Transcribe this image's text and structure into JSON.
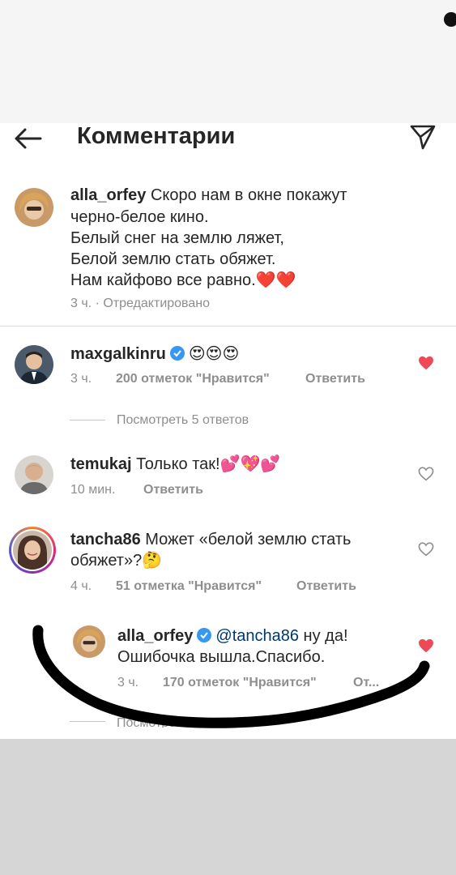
{
  "header": {
    "title": "Комментарии"
  },
  "caption": {
    "username": "alla_orfey",
    "lines": [
      "Скоро нам в окне покажут",
      "черно-белое кино.",
      "Белый снег на землю ляжет,",
      "Белой землю стать обяжет.",
      "Нам кайфово все равно.❤️❤️"
    ],
    "time": "3 ч.",
    "edited": "· Отредактировано"
  },
  "comments": [
    {
      "username": "maxgalkinru",
      "text": "😍😍😍",
      "time": "3 ч.",
      "likes": "200 отметок \"Нравится\"",
      "reply": "Ответить",
      "liked": true,
      "view_replies": "Посмотреть 5 ответов"
    },
    {
      "username": "temukaj",
      "text": "Только так!💕💖💕",
      "time": "10 мин.",
      "reply": "Ответить",
      "liked": false
    },
    {
      "username": "tancha86",
      "text_line1": "Может «белой землю стать",
      "text_line2": "обяжет»?🤔",
      "time": "4 ч.",
      "likes": "51 отметка \"Нравится\"",
      "reply": "Ответить",
      "liked": false
    }
  ],
  "reply": {
    "username": "alla_orfey",
    "mention": "@tancha86",
    "text_rest": " ну да!",
    "text_line2": "Ошибочка вышла.Спасибо.",
    "time": "3 ч.",
    "likes": "170 отметок \"Нравится\"",
    "reply_truncated": "От...",
    "liked": true
  },
  "hidden_view_replies": "Посмотреть ответов",
  "colors": {
    "like_red": "#ed4956",
    "verified_blue": "#3897f0",
    "meta_gray": "#8e8e8e"
  }
}
